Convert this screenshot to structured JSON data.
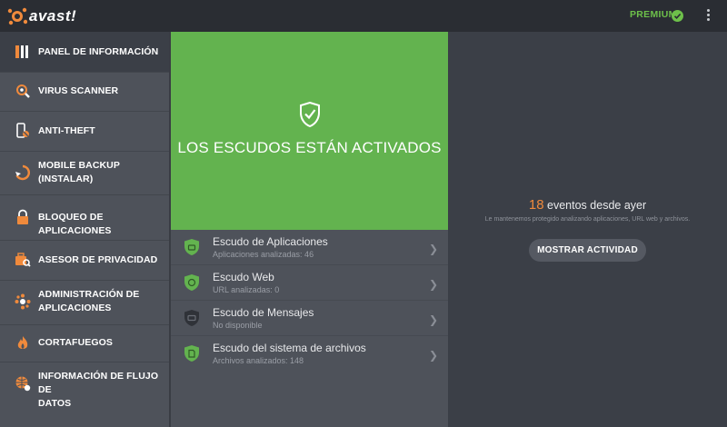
{
  "app": {
    "logo_text": "avast!",
    "premium_label": "PREMIUM"
  },
  "sidebar": {
    "items": [
      {
        "label": "PANEL DE INFORMACIÓN",
        "icon": "dashboard-icon"
      },
      {
        "label": "VIRUS SCANNER",
        "icon": "scanner-icon"
      },
      {
        "label": "ANTI-THEFT",
        "icon": "anti-theft-icon"
      },
      {
        "label_line1": "MOBILE BACKUP",
        "label_line2": "(INSTALAR)",
        "icon": "backup-icon"
      },
      {
        "label": "BLOQUEO DE APLICACIONES",
        "icon": "lock-icon"
      },
      {
        "label": "ASESOR DE PRIVACIDAD",
        "icon": "privacy-icon"
      },
      {
        "label_line1": "ADMINISTRACIÓN DE",
        "label_line2": "APLICACIONES",
        "icon": "apps-manager-icon"
      },
      {
        "label": "CORTAFUEGOS",
        "icon": "firewall-icon"
      },
      {
        "label_line1": "INFORMACIÓN DE FLUJO DE",
        "label_line2": "DATOS",
        "icon": "data-flow-icon"
      }
    ]
  },
  "status": {
    "title": "LOS ESCUDOS ESTÁN ACTIVADOS"
  },
  "shields": [
    {
      "title": "Escudo de Aplicaciones",
      "subtitle": "Aplicaciones analizadas: 46",
      "state": "active"
    },
    {
      "title": "Escudo Web",
      "subtitle": "URL analizadas: 0",
      "state": "active"
    },
    {
      "title": "Escudo de Mensajes",
      "subtitle": "No disponible",
      "state": "unavailable"
    },
    {
      "title": "Escudo del sistema de archivos",
      "subtitle": "Archivos analizados: 148",
      "state": "active"
    }
  ],
  "activity": {
    "count": "18",
    "count_suffix": "eventos desde ayer",
    "description": "Le mantenemos protegido analizando aplicaciones, URL web y archivos.",
    "button_label": "MOSTRAR ACTIVIDAD"
  },
  "colors": {
    "accent_green": "#63b34f",
    "accent_orange": "#f08a3c",
    "sidebar_bg": "#4e525a",
    "main_bg": "#3b3f47"
  }
}
